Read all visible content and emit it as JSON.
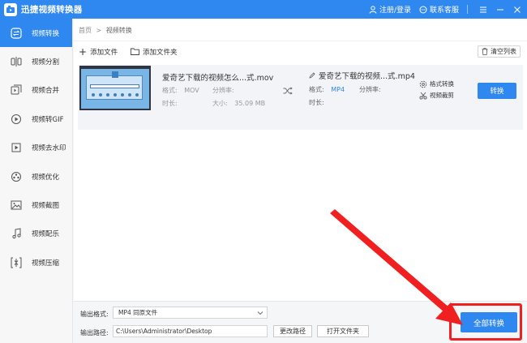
{
  "app": {
    "title": "迅捷视频转换器"
  },
  "titlebar": {
    "login_label": "注册/登录",
    "support_label": "联系客服"
  },
  "sidebar": {
    "items": [
      {
        "label": "视频转换",
        "icon": "convert-icon",
        "active": true
      },
      {
        "label": "视频分割",
        "icon": "split-icon"
      },
      {
        "label": "视频合并",
        "icon": "merge-icon"
      },
      {
        "label": "视频转GIF",
        "icon": "gif-icon"
      },
      {
        "label": "视频去水印",
        "icon": "watermark-icon"
      },
      {
        "label": "视频优化",
        "icon": "optimize-icon"
      },
      {
        "label": "视频截图",
        "icon": "screenshot-icon"
      },
      {
        "label": "视频配乐",
        "icon": "music-icon"
      },
      {
        "label": "视频压缩",
        "icon": "compress-icon"
      }
    ]
  },
  "breadcrumb": {
    "home": "首页",
    "separator": ">",
    "current": "视频转换"
  },
  "toolbar": {
    "add_file_label": "添加文件",
    "add_folder_label": "添加文件夹",
    "clear_list_label": "清空列表"
  },
  "file": {
    "source": {
      "name": "爱奇艺下载的视频怎么...式.mov",
      "format_label": "格式:",
      "format_value": "MOV",
      "resolution_label": "分辨率:",
      "resolution_value": "",
      "duration_label": "时长:",
      "duration_value": "",
      "size_label": "大小:",
      "size_value": "35.09 MB"
    },
    "target": {
      "name": "爱奇艺下载的视频...式.mp4",
      "format_label": "格式:",
      "format_value": "MP4",
      "resolution_label": "分辨率:",
      "duration_label": "时长:"
    },
    "options": {
      "format_convert_label": "格式转换",
      "video_cut_label": "视频裁剪"
    },
    "convert_label": "转换"
  },
  "bottom": {
    "output_format_label": "输出格式:",
    "output_format_value": "MP4  同原文件",
    "output_path_label": "输出路径:",
    "output_path_value": "C:\\Users\\Administrator\\Desktop",
    "change_path_label": "更改路径",
    "open_folder_label": "打开文件夹",
    "convert_all_label": "全部转换"
  },
  "colors": {
    "accent": "#2f87f0",
    "annotation": "#f02020"
  }
}
